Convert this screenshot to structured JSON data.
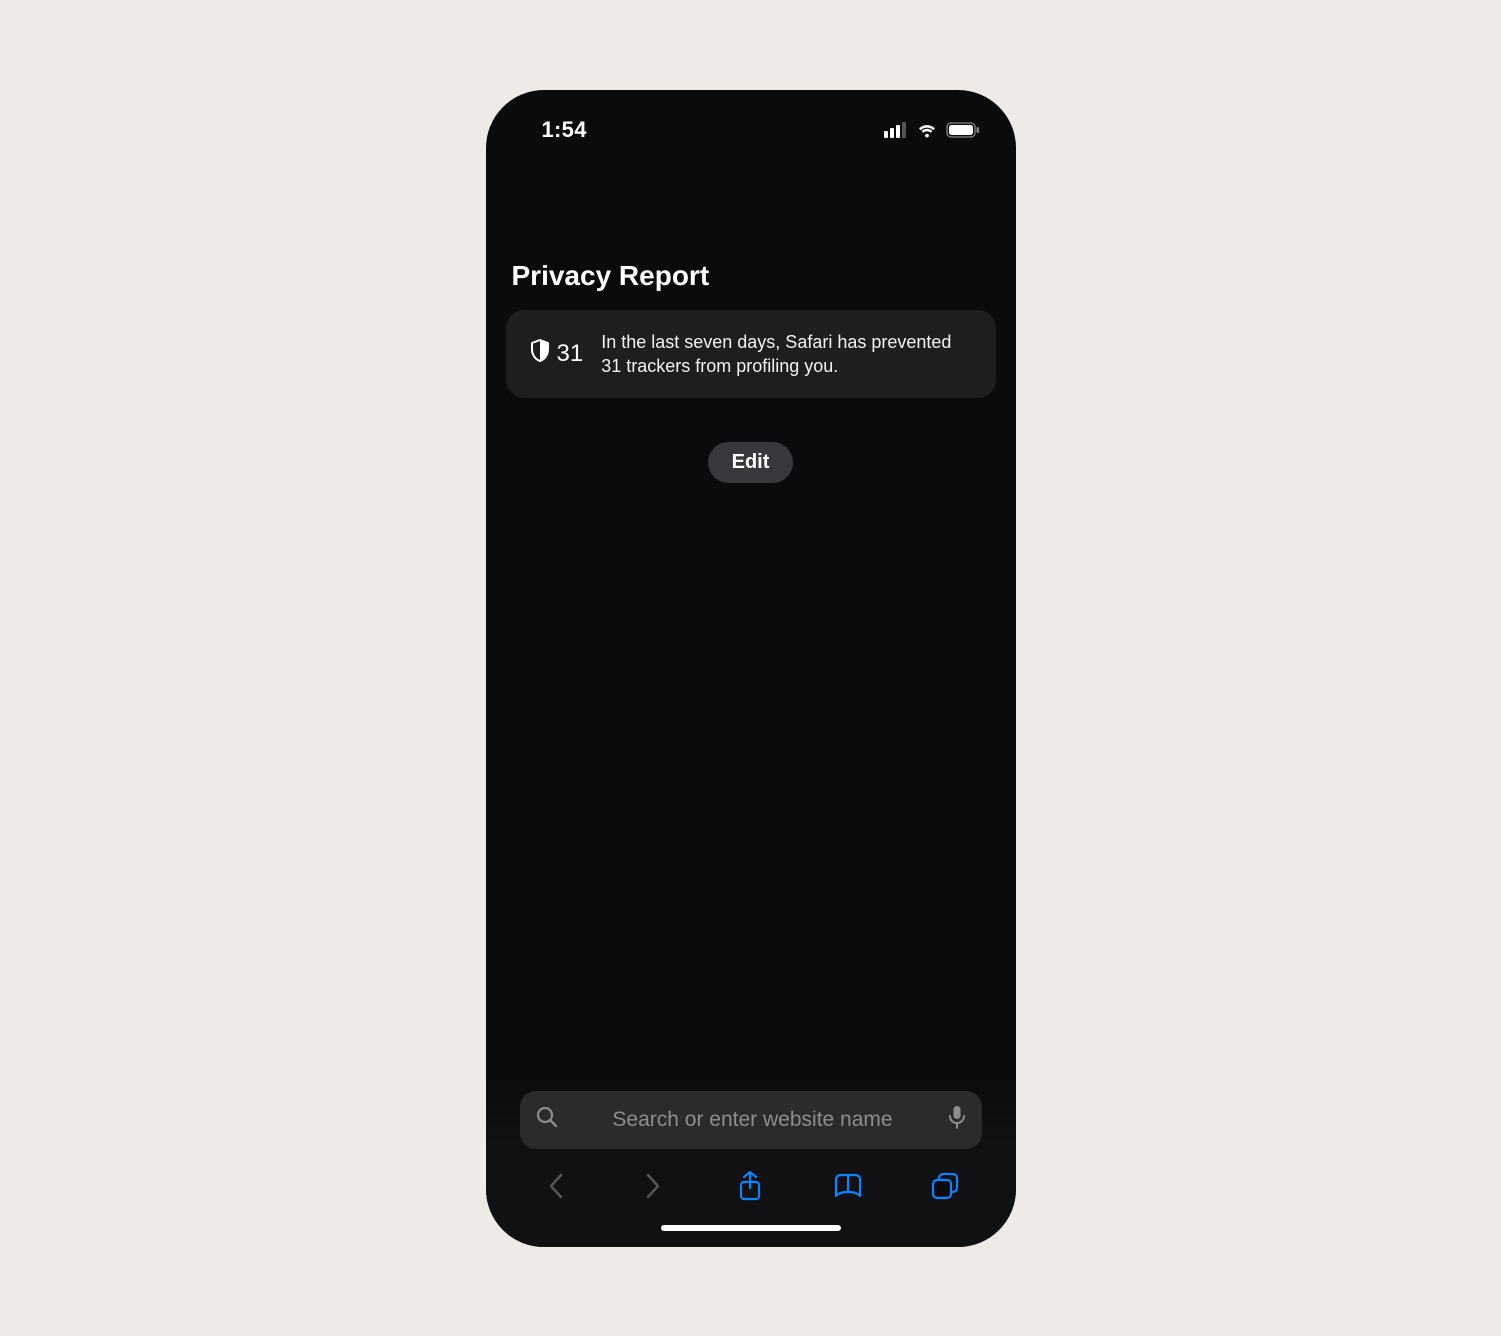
{
  "status": {
    "time": "1:54"
  },
  "page": {
    "title": "Privacy Report",
    "tracker_count": "31",
    "summary": "In the last seven days, Safari has prevented 31 trackers from profiling you.",
    "edit_label": "Edit"
  },
  "address": {
    "placeholder": "Search or enter website name"
  }
}
